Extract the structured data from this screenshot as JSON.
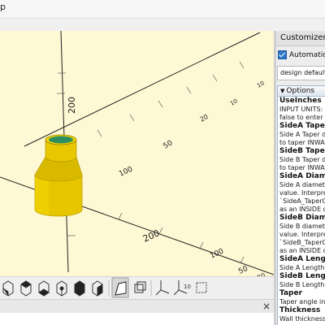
{
  "menubar": {
    "visible_text": "p"
  },
  "viewport": {
    "axis_labels": [
      "200",
      "200",
      "100",
      "100",
      "50",
      "50",
      "20",
      "20",
      "10",
      "10"
    ],
    "model_color": "#f0d000"
  },
  "toolbar": {
    "buttons": [
      "view-right-icon",
      "view-top-icon",
      "view-bottom-icon",
      "view-left-icon",
      "view-front-icon",
      "view-back-icon",
      "perspective-icon",
      "orthogonal-icon",
      "show-axes-icon",
      "show-scale-markers-icon",
      "show-edges-icon"
    ]
  },
  "console": {
    "close_glyph": "×"
  },
  "customizer": {
    "title": "Customizer",
    "auto_preview": "Automatic Pr",
    "preset": "design default v",
    "options_title": "Options",
    "params": [
      {
        "name": "UseInches",
        "desc": [
          "INPUT UNITS: S",
          "false to enter in"
        ]
      },
      {
        "name": "SideA TaperO",
        "desc": [
          "Side A Taper di",
          "to taper INWAR"
        ]
      },
      {
        "name": "SideB TaperO",
        "desc": [
          "Side B Taper di",
          "to taper INWAR"
        ]
      },
      {
        "name": "SideA Diame",
        "desc": [
          "Side A diamete",
          "value. Interpre",
          "`SideA_TaperO",
          "as an INSIDE d"
        ]
      },
      {
        "name": "SideB Diame",
        "desc": [
          "Side B diamete",
          "value. Interpre",
          "`SideB_TaperO",
          "as an INSIDE d"
        ]
      },
      {
        "name": "SideA Length",
        "desc": [
          "Side A Length"
        ]
      },
      {
        "name": "SideB Length",
        "desc": [
          "Side B Length"
        ]
      },
      {
        "name": "Taper",
        "desc": [
          "Taper angle in d"
        ]
      },
      {
        "name": "Thickness",
        "desc": [
          "Wall thickness"
        ]
      }
    ]
  }
}
